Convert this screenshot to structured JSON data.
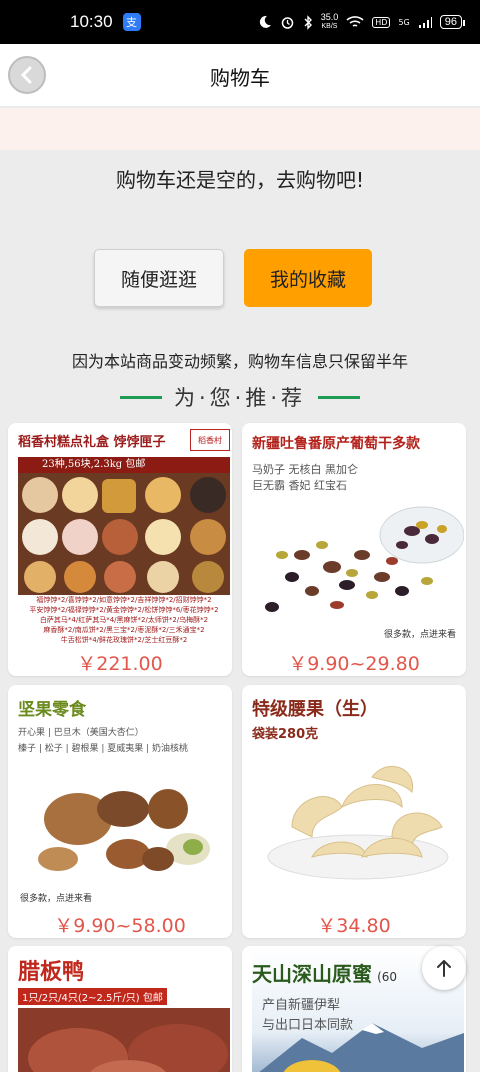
{
  "status": {
    "time": "10:30",
    "speed_value": "35.0",
    "speed_unit": "KB/S",
    "hd": "HD",
    "network": "5G",
    "battery": "96"
  },
  "nav": {
    "title": "购物车"
  },
  "empty": {
    "message": "购物车还是空的，去购物吧!",
    "browse_label": "随便逛逛",
    "favorites_label": "我的收藏",
    "hint": "因为本站商品变动频繁，购物车信息只保留半年"
  },
  "recommend": {
    "title": "为·您·推·荐"
  },
  "products": [
    {
      "title": "稻香村糕点礼盒 饽饽匣子",
      "subtitle": "23种,56块,2.3kg 包邮",
      "brand": "稻香村",
      "detail_lines": [
        "福饽饽*2/喜饽饽*2/如意饽饽*2/吉祥饽饽*2/招财饽饽*2",
        "平安饽饽*2/福禄饽饽*2/黄金饽饽*2/松饼饽饽*6/枣花饽饽*2",
        "白萨其马*4/红萨其马*4/黑麻饼*2/太师饼*2/乌梅酥*2",
        "麻香酥*2/南瓜饼*2/黑三宝*2/枣泥酥*2/三禾通宝*2",
        "牛舌松饼*4/鲜花玫瑰饼*2/芝士红豆酥*2"
      ],
      "price": "￥221.00"
    },
    {
      "title": "新疆吐鲁番原产葡萄干多款",
      "tags": [
        "马奶子 无核白 黑加仑",
        "巨无霸 香妃 红宝石"
      ],
      "badge": "很多款，点进来看",
      "price": "￥9.90~29.80"
    },
    {
      "title": "坚果零食",
      "tags": [
        "开心果 | 巴旦木（美国大杏仁）",
        "榛子 | 松子 | 碧根果 | 夏威夷果 | 奶油核桃"
      ],
      "badge": "很多款，点进来看",
      "price": "￥9.90~58.00"
    },
    {
      "title": "特级腰果（生）",
      "subtitle": "袋装280克",
      "price": "￥34.80"
    },
    {
      "title": "腊板鸭",
      "subtitle": "1只/2只/4只(2~2.5斤/只) 包邮"
    },
    {
      "title": "天山深山原蜜",
      "title_suffix": "(60",
      "tags": [
        "产自新疆伊犁",
        "与出口日本同款"
      ]
    }
  ],
  "colors": {
    "accent_orange": "#ff9f00",
    "price_red": "#e2574c",
    "recommend_green": "#1e9b55",
    "notice_bg": "#fdf1ed"
  },
  "icons": {
    "back": "chevron-left-icon",
    "scroll_top": "arrow-up-icon",
    "status": [
      "moon-icon",
      "alarm-icon",
      "bluetooth-icon",
      "wifi-icon",
      "signal-icon",
      "battery-icon"
    ]
  }
}
